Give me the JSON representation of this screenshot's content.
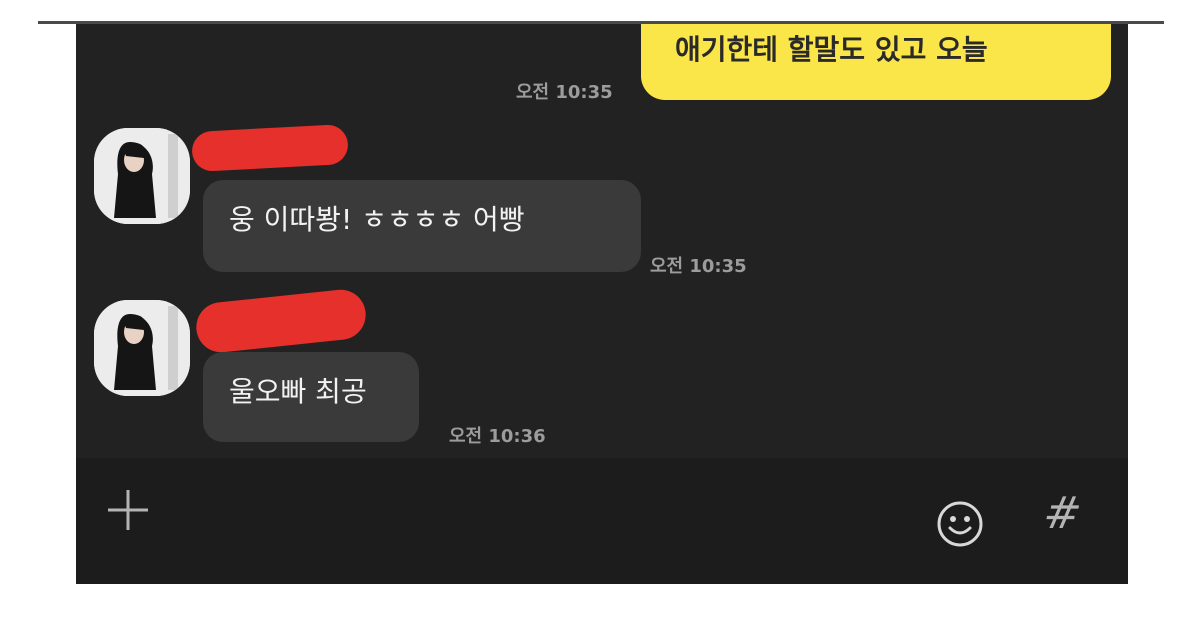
{
  "messages": [
    {
      "side": "sent",
      "text": "애기한테 할말도 있고 오늘",
      "time": "오전 10:35"
    },
    {
      "side": "received",
      "text": "웅 이따봥! ㅎㅎㅎㅎ 어빵",
      "time": "오전 10:35"
    },
    {
      "side": "received",
      "text": "울오빠 최공",
      "time": "오전 10:36"
    }
  ],
  "composer": {
    "left_icon": "plus-icon",
    "right_icons": [
      "emoticon-icon",
      "hashtag-icon"
    ],
    "hashtag_glyph": "#"
  },
  "colors": {
    "chat_background": "#222222",
    "sent_bubble": "#fbe64a",
    "received_bubble": "#3a3a3a",
    "timestamp": "#9c9c9c",
    "redaction": "#e5302c"
  }
}
